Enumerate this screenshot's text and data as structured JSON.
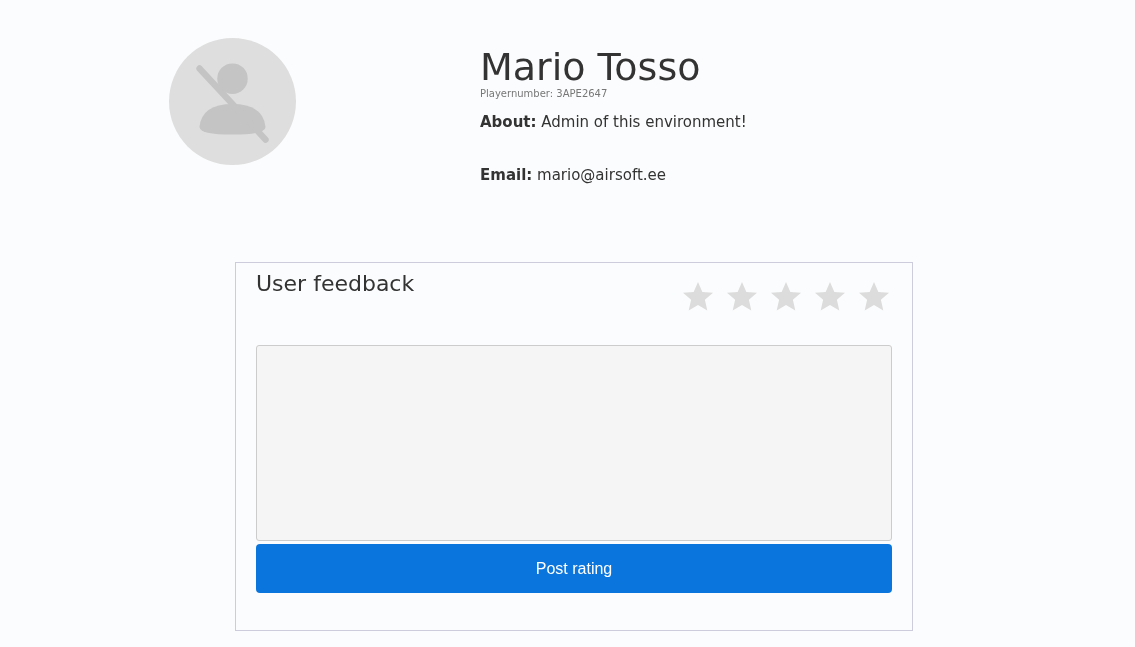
{
  "profile": {
    "name": "Mario Tosso",
    "player_number": "Playernumber: 3APE2647",
    "about_label": "About:",
    "about": "Admin of this environment!",
    "email_label": "Email:",
    "email": "mario@airsoft.ee"
  },
  "feedback": {
    "title": "User feedback",
    "stars": 0,
    "button": "Post rating"
  }
}
